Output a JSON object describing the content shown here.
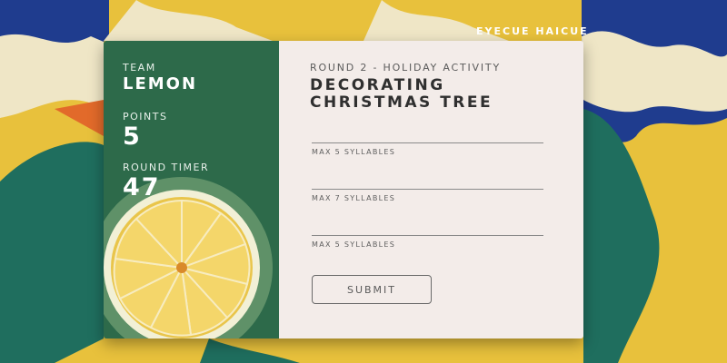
{
  "brand": "EYECUE HAICUE",
  "team": {
    "label": "TEAM",
    "name": "LEMON"
  },
  "points": {
    "label": "POINTS",
    "value": "5"
  },
  "timer": {
    "label": "ROUND TIMER",
    "value": "47"
  },
  "round": {
    "subtitle": "ROUND 2 - HOLIDAY ACTIVITY",
    "title_line1": "DECORATING",
    "title_line2": "CHRISTMAS TREE"
  },
  "fields": [
    {
      "hint": "MAX 5 SYLLABLES",
      "value": ""
    },
    {
      "hint": "MAX 7 SYLLABLES",
      "value": ""
    },
    {
      "hint": "MAX 5 SYLLABLES",
      "value": ""
    }
  ],
  "submit_label": "SUBMIT",
  "colors": {
    "panel_green": "#2d6a4a",
    "card_bg": "#f3ece9",
    "bg_yellow": "#e8c13c",
    "bg_blue": "#1e3a8c"
  }
}
